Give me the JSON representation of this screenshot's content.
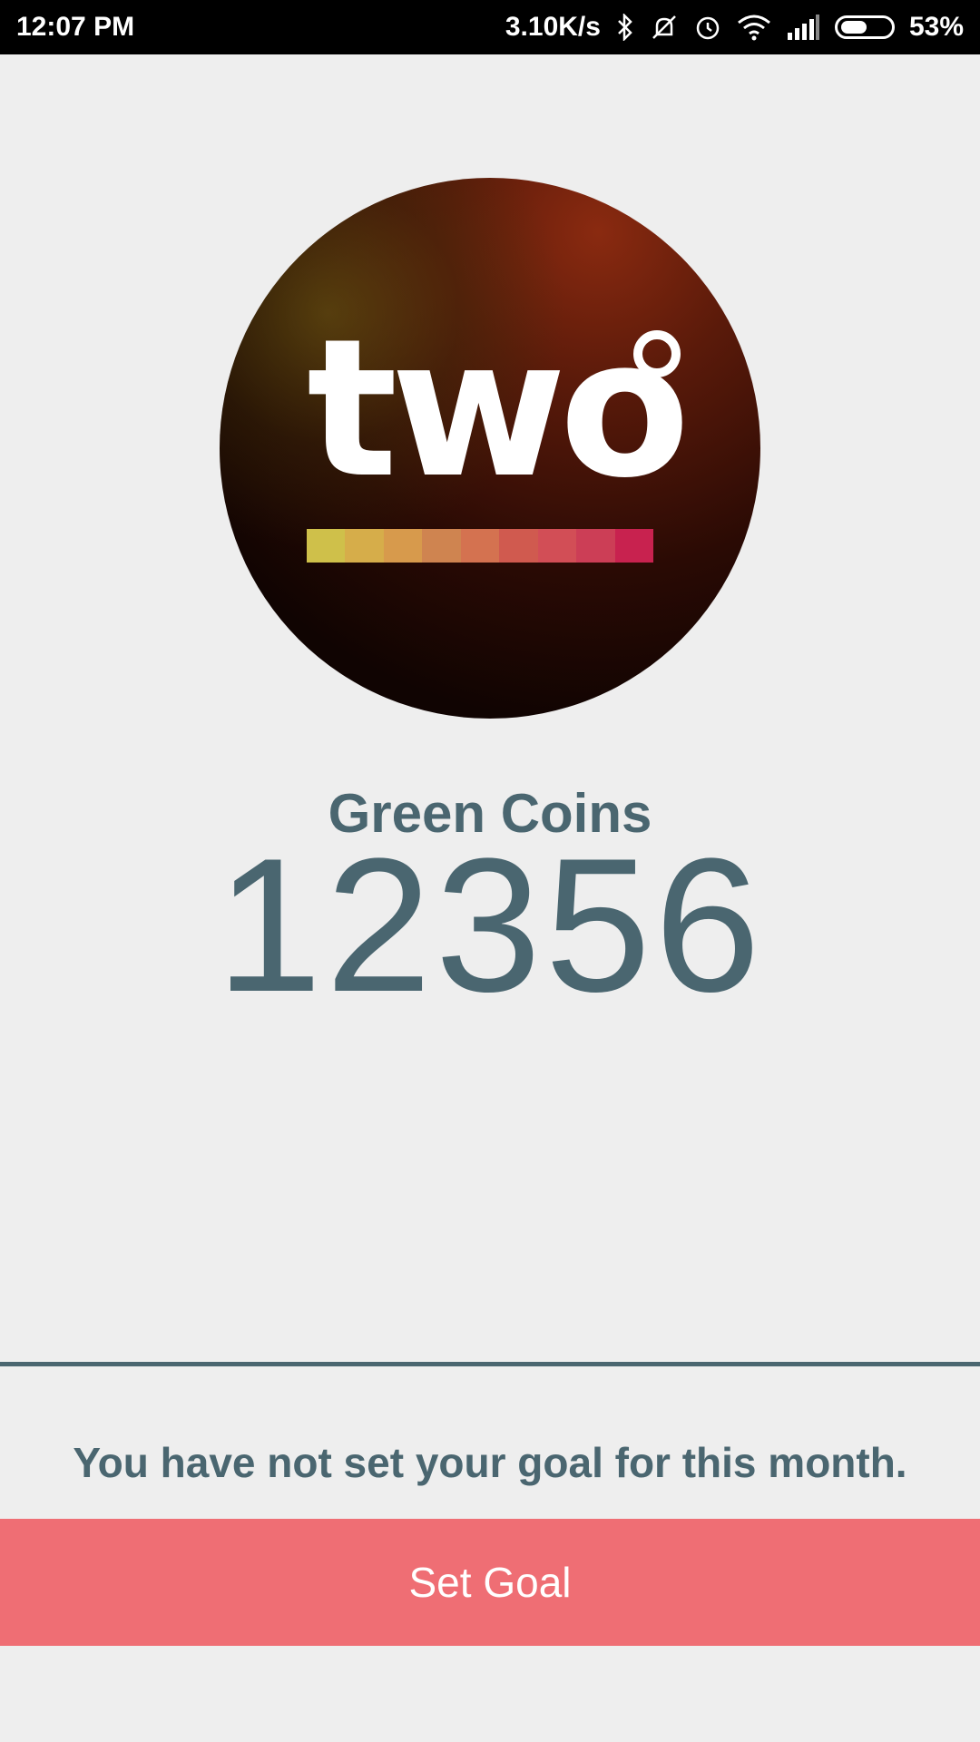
{
  "status_bar": {
    "time": "12:07 PM",
    "network_speed": "3.10K/s",
    "battery": "53%",
    "battery_level": 0.53,
    "icons": [
      "bluetooth-icon",
      "silent-icon",
      "alarm-icon",
      "wifi-icon",
      "signal-icon",
      "battery-icon"
    ]
  },
  "logo": {
    "text": "two",
    "bar_colors": [
      "#cfc04a",
      "#d6ad4a",
      "#d79a4c",
      "#cf8450",
      "#d47250",
      "#d05a4f",
      "#d24e56",
      "#cc3e56",
      "#c8224f"
    ]
  },
  "coins": {
    "label": "Green Coins",
    "value": "12356"
  },
  "goal": {
    "message": "You have not set your goal for this month.",
    "button_label": "Set Goal"
  },
  "colors": {
    "text": "#4a6670",
    "button": "#ef6e74",
    "background": "#eeeeee"
  }
}
